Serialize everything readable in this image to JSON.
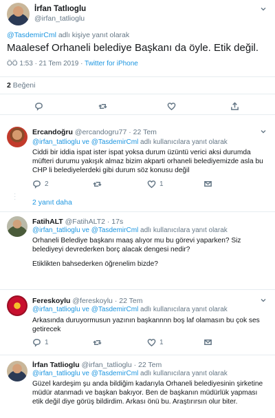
{
  "tweet": {
    "name": "İrfan Tatlıoglu",
    "handle": "@irfan_tatlioglu",
    "reply_mention": "@TasdemirCml",
    "reply_suffix": "adlı kişiye yanıt olarak",
    "text": "Maalesef Orhaneli belediye Başkanı da öyle. Etik değil.",
    "time": "ÖÖ 1:53 · 21 Tem 2019 ·",
    "source": "Twitter for iPhone",
    "likes_count": "2",
    "likes_label": "Beğeni"
  },
  "replies": [
    {
      "name": "Ercandoğru",
      "handle": "@ercandogru77",
      "date": "· 22 Tem",
      "mentions": "@irfan_tatlioglu ve @TasdemirCml",
      "reply_suffix": "adlı kullanıcılara yanıt olarak",
      "paragraphs": [
        "Ciddi bir iddia ispat ister ispat yoksa durum üzüntü verici aksi durumda müfteri durumu yakışık almaz bizim akparti orhaneli belediyemizde asla bu CHP li belediyelerdeki gibi durum söz konusu değil"
      ],
      "reply_count": "2",
      "retweet_count": "",
      "like_count": "1",
      "show_more": "2 yanıt daha"
    },
    {
      "name": "FatihALT",
      "handle": "@FatihALT2",
      "date": "· 17s",
      "mentions": "@irfan_tatlioglu ve @TasdemirCml",
      "reply_suffix": "adlı kullanıcılara yanıt olarak",
      "paragraphs": [
        "Orhaneli Belediye başkanı maaş alıyor mu bu görevi yaparken? Siz belediyeyi devrederken borç alacak dengesi nedir?",
        "Etiklikten bahsederken öğrenelim bizde?"
      ]
    },
    {
      "name": "Fereskoylu",
      "handle": "@fereskoylu",
      "date": "· 22 Tem",
      "mentions": "@irfan_tatlioglu ve @TasdemirCml",
      "reply_suffix": "adlı kullanıcılara yanıt olarak",
      "paragraphs": [
        "Arkasında duruyormusun   yazının  başkannnn boş laf olamasın bu çok ses getirecek"
      ],
      "reply_count": "1",
      "retweet_count": "",
      "like_count": "1"
    },
    {
      "name": "İrfan Tatlioglu",
      "handle": "@irfan_tatlioglu",
      "date": "· 22 Tem",
      "mentions": "@irfan_tatlioglu ve @TasdemirCml",
      "reply_suffix": "adlı kullanıcılara yanıt olarak",
      "paragraphs": [
        "Güzel kardeşim şu anda bildiğim kadarıyla Orhaneli belediyesinin şirketine müdür atanmadı ve başkan bakıyor. Ben de başkanın müdürlük yapması etik değil diye görüş bildirdim. Arkası önü bu. Araştırırsın olur biter."
      ]
    }
  ],
  "colors": {
    "accent": "#1b95e0",
    "muted": "#657786",
    "like": "#e0245e"
  },
  "icons": [
    "reply-icon",
    "retweet-icon",
    "like-icon",
    "share-icon",
    "chevron-down-icon"
  ]
}
